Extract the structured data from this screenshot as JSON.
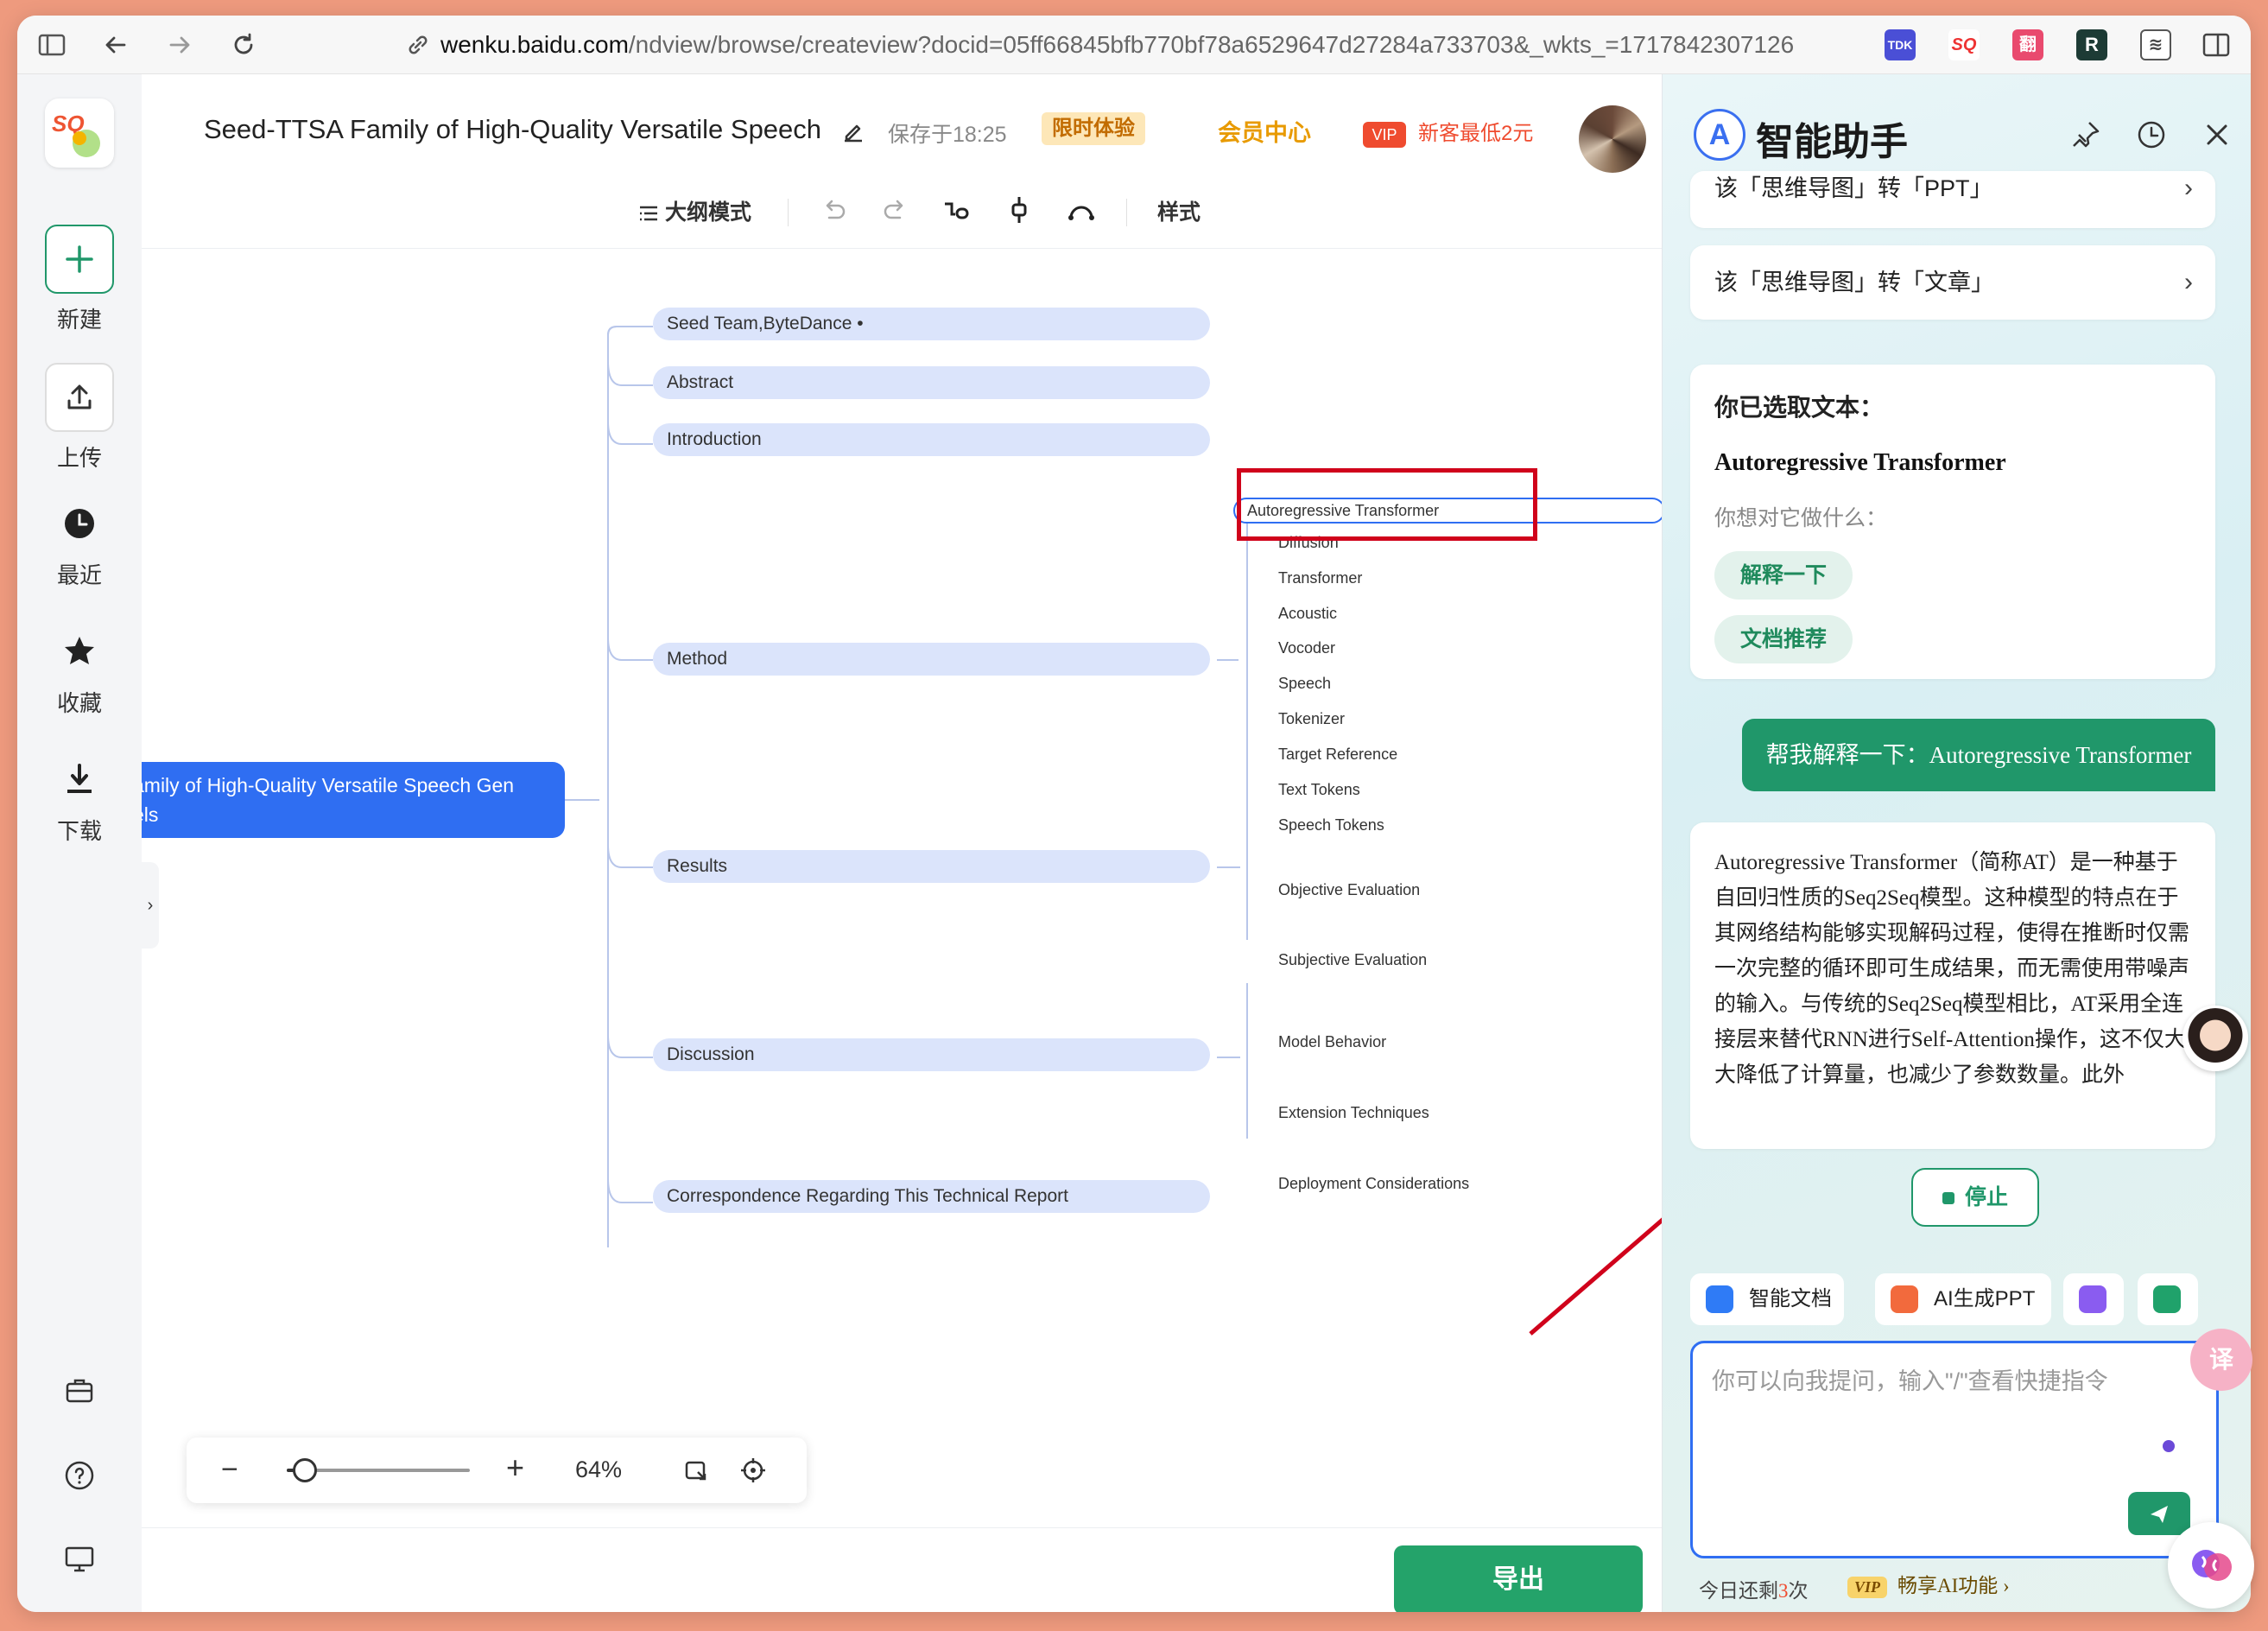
{
  "browser": {
    "url_host": "wenku.baidu.com",
    "url_path": "/ndview/browse/createview?docid=05ff66845bfb770bf78a6529647d27284a733703&_wkts_=1717842307126",
    "extensions": [
      "TDK",
      "SQ",
      "翻",
      "R",
      "≋"
    ]
  },
  "rail": {
    "new": "新建",
    "upload": "上传",
    "recent": "最近",
    "favorites": "收藏",
    "download": "下载"
  },
  "header": {
    "title": "Seed-TTSA Family of High-Quality Versatile Speech",
    "saved": "保存于18:25",
    "trial": "限时体验",
    "member_center": "会员中心",
    "vip_badge": "VIP",
    "promo": "新客最低2元"
  },
  "toolbar": {
    "outline_mode": "大纲模式",
    "style": "样式"
  },
  "mindmap": {
    "root_lines": [
      "amily of High-Quality Versatile Speech Gen",
      "els"
    ],
    "branches": [
      "Seed Team,ByteDance",
      "Abstract",
      "Introduction",
      "Method",
      "Results",
      "Discussion",
      "Correspondence Regarding This Technical Report"
    ],
    "method_children": [
      "Autoregressive Transformer",
      "Diffusion",
      "Transformer",
      "Acoustic",
      "Vocoder",
      "Speech",
      "Tokenizer",
      "Target Reference",
      "Text Tokens",
      "Speech Tokens"
    ],
    "results_children": [
      "Objective Evaluation",
      "Subjective Evaluation"
    ],
    "discussion_children": [
      "Model Behavior",
      "Extension Techniques",
      "Deployment Considerations"
    ]
  },
  "zoom": {
    "minus": "−",
    "plus": "+",
    "level_text": "64%",
    "slider_fraction": 0.1
  },
  "footer": {
    "export": "导出"
  },
  "assistant": {
    "title": "智能助手",
    "suggestions": [
      "该「思维导图」转「PPT」",
      "该「思维导图」转「文章」"
    ],
    "selected_heading": "你已选取文本：",
    "selected_term": "Autoregressive Transformer",
    "question": "你想对它做什么：",
    "chips": [
      "解释一下",
      "文档推荐"
    ],
    "user_message": "帮我解释一下：Autoregressive Transformer",
    "answer": "Autoregressive Transformer（简称AT）是一种基于自回归性质的Seq2Seq模型。这种模型的特点在于其网络结构能够实现解码过程，使得在推断时仅需一次完整的循环即可生成结果，而无需使用带噪声的输入。与传统的Seq2Seq模型相比，AT采用全连接层来替代RNN进行Self-Attention操作，这不仅大大降低了计算量，也减少了参数数量。此外",
    "stop": "停止",
    "tools": [
      "智能文档",
      "AI生成PPT"
    ],
    "input_placeholder": "你可以向我提问，输入\"/\"查看快捷指令",
    "quota_prefix": "今日还剩",
    "quota_count": "3",
    "quota_suffix": "次",
    "vip_label": "VIP",
    "ai_features": "畅享AI功能 ›",
    "translate_label": "译"
  },
  "colors": {
    "accent_blue": "#2f6ef2",
    "node_fill": "#dbe4fb",
    "green": "#20976a",
    "highlight_red": "#d0021b"
  }
}
